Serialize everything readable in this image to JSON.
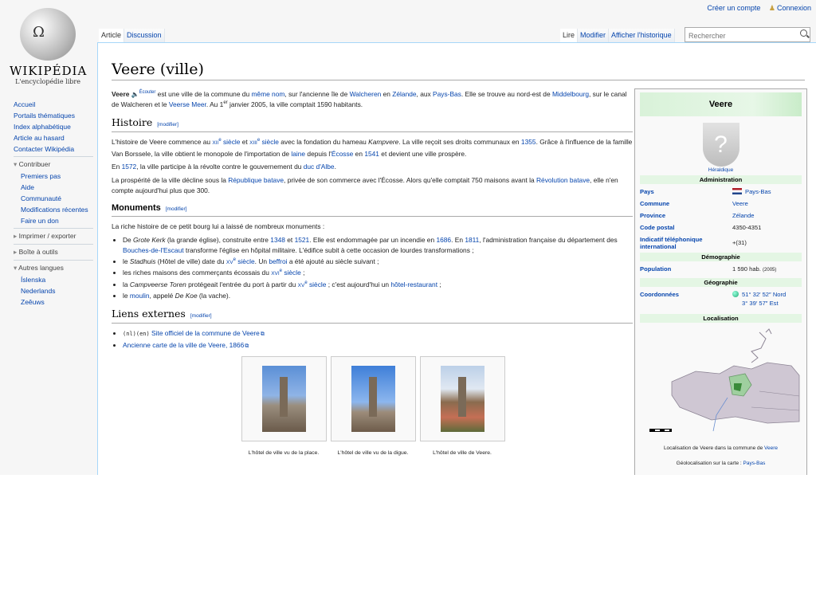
{
  "personal": {
    "create_account": "Créer un compte",
    "login": "Connexion"
  },
  "logo": {
    "title": "WIKIPÉDIA",
    "subtitle": "L'encyclopédie libre"
  },
  "sidebar": {
    "nav": [
      "Accueil",
      "Portails thématiques",
      "Index alphabétique",
      "Article au hasard",
      "Contacter Wikipédia"
    ],
    "contribuer": {
      "heading": "Contribuer",
      "items": [
        "Premiers pas",
        "Aide",
        "Communauté",
        "Modifications récentes",
        "Faire un don"
      ]
    },
    "imprimer": "Imprimer / exporter",
    "boite": "Boîte à outils",
    "langues": {
      "heading": "Autres langues",
      "items": [
        "Íslenska",
        "Nederlands",
        "Zeêuws"
      ]
    }
  },
  "tabs": {
    "article": "Article",
    "discussion": "Discussion",
    "lire": "Lire",
    "modifier": "Modifier",
    "historique": "Afficher l'historique"
  },
  "search": {
    "placeholder": "Rechercher"
  },
  "article": {
    "title": "Veere (ville)",
    "edit": "[modifier]",
    "intro": {
      "term": "Veere",
      "ecouter": "Écouter",
      "t1": " est une ville de la commune du ",
      "l1": "même nom",
      "t2": ", sur l'ancienne île de ",
      "l2": "Walcheren",
      "t3": " en ",
      "l3": "Zélande",
      "t4": ", aux ",
      "l4": "Pays-Bas",
      "t5": ". Elle se trouve au nord-est de ",
      "l5": "Middelbourg",
      "t6": ", sur le canal de Walcheren et le ",
      "l6": "Veerse Meer",
      "t7": ". Au 1",
      "sup": "er",
      "t8": " janvier 2005, la ville comptait 1590 habitants."
    },
    "histoire": {
      "heading": "Histoire",
      "p1": {
        "t1": "L'histoire de Veere commence au ",
        "l1": "XII",
        "s1": "e",
        "l1b": " siècle",
        "t2": " et ",
        "l2": "XIII",
        "s2": "e",
        "l2b": " siècle",
        "t3": " avec la fondation du hameau ",
        "em": "Kampvere",
        "t4": ". La ville reçoit ses droits communaux en ",
        "l3": "1355",
        "t5": ". Grâce à l'influence de la famille Van Borssele, la ville obtient le monopole de l'importation de ",
        "l4": "laine",
        "t6": " depuis l'",
        "l5": "Écosse",
        "t7": " en ",
        "l6": "1541",
        "t8": " et devient une ville prospère."
      },
      "p2": {
        "t1": "En ",
        "l1": "1572",
        "t2": ", la ville participe à la révolte contre le gouvernement du ",
        "l2": "duc d'Albe",
        "t3": "."
      },
      "p3": {
        "t1": "La prospérité de la ville décline sous la ",
        "l1": "République batave",
        "t2": ", privée de son commerce avec l'Écosse. Alors qu'elle comptait 750 maisons avant la ",
        "l2": "Révolution batave",
        "t3": ", elle n'en compte aujourd'hui plus que 300."
      }
    },
    "monuments": {
      "heading": "Monuments",
      "intro": "La riche histoire de ce petit bourg lui a laissé de nombreux monuments :",
      "li1": {
        "t1": "De ",
        "em": "Grote Kerk",
        "t2": " (la grande église), construite entre ",
        "l1": "1348",
        "t3": " et ",
        "l2": "1521",
        "t4": ". Elle est endommagée par un incendie en ",
        "l3": "1686",
        "t5": ". En ",
        "l4": "1811",
        "t6": ", l'administration française du département des ",
        "l5": "Bouches-de-l'Escaut",
        "t7": " transforme l'église en hôpital militaire. L'édifice subit à cette occasion de lourdes transformations ;"
      },
      "li2": {
        "t1": "le ",
        "em": "Stadhuis",
        "t2": " (Hôtel de ville) date du ",
        "l1": "XV",
        "s1": "e",
        "l1b": " siècle",
        "t3": ". Un ",
        "l2": "beffroi",
        "t4": " a été ajouté au siècle suivant ;"
      },
      "li3": {
        "t1": "les riches maisons des commerçants écossais du ",
        "l1": "XVI",
        "s1": "e",
        "l1b": " siècle",
        "t2": " ;"
      },
      "li4": {
        "t1": "la ",
        "em": "Campveerse Toren",
        "t2": " protégeait l'entrée du port à partir du ",
        "l1": "XV",
        "s1": "e",
        "l1b": " siècle",
        "t3": " ; c'est aujourd'hui un ",
        "l2": "hôtel-restaurant",
        "t4": " ;"
      },
      "li5": {
        "t1": "le ",
        "l1": "moulin",
        "t2": ", appelé ",
        "em": "De Koe",
        "t3": " (la vache)."
      }
    },
    "liens": {
      "heading": "Liens externes",
      "l1code": "(nl)(en)",
      "l1": "Site officiel de la commune de Veere",
      "l2": "Ancienne carte de la ville de Veere, 1866"
    },
    "gallery": [
      "L'hôtel de ville vu de la place.",
      "L'hôtel de ville vu de la digue.",
      "L'hôtel de ville de Veere."
    ]
  },
  "infobox": {
    "title": "Veere",
    "heraldique": "Héraldique",
    "administration": "Administration",
    "rows": [
      {
        "k": "Pays",
        "v": "Pays-Bas"
      },
      {
        "k": "Commune",
        "v": "Veere"
      },
      {
        "k": "Province",
        "v": "Zélande"
      },
      {
        "k": "Code postal",
        "v": "4350-4351"
      },
      {
        "k": "Indicatif téléphonique international",
        "v": "+(31)"
      }
    ],
    "demographie": "Démographie",
    "population_k": "Population",
    "population_v": "1 590 hab.",
    "population_y": "(2005)",
    "geographie": "Géographie",
    "coord_k": "Coordonnées",
    "coord_v1": "51° 32′ 52″ Nord",
    "coord_v2": "3° 39′ 57″ Est",
    "localisation": "Localisation",
    "map_caption_t": "Localisation de Veere dans la commune de ",
    "map_caption_l": "Veere",
    "geo_t": "Géolocalisation sur la carte : ",
    "geo_l": "Pays-Bas"
  }
}
